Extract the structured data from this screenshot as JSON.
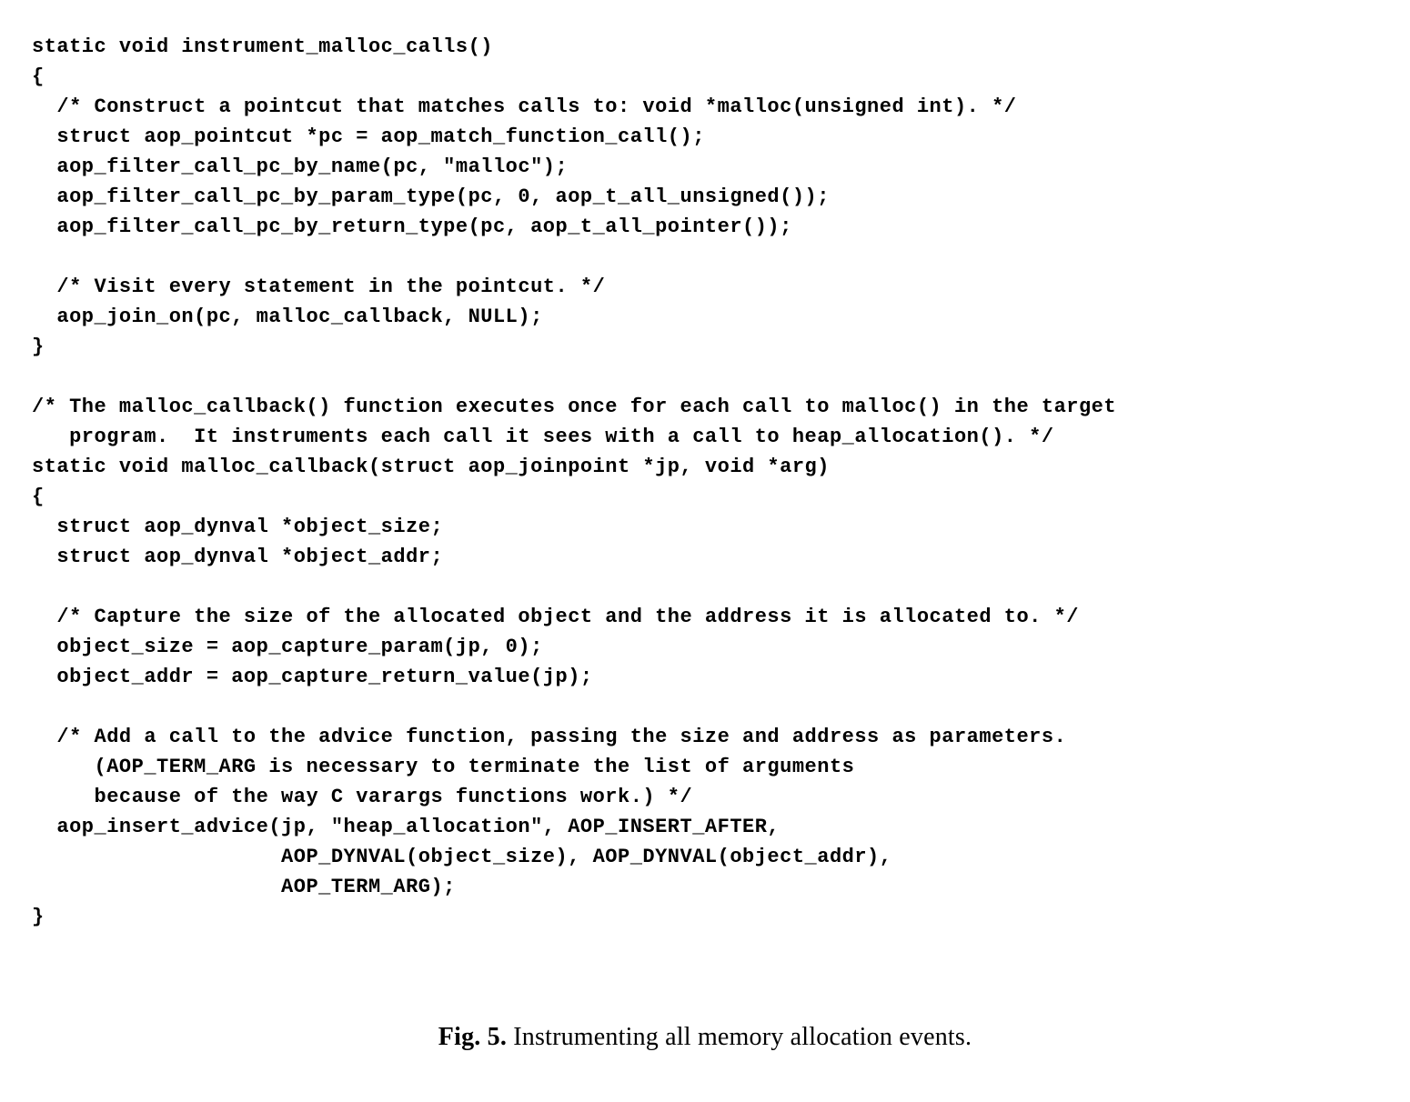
{
  "code": {
    "line1": "static void instrument_malloc_calls()",
    "line2": "{",
    "line3": "  /* Construct a pointcut that matches calls to: void *malloc(unsigned int). */",
    "line4": "  struct aop_pointcut *pc = aop_match_function_call();",
    "line5": "  aop_filter_call_pc_by_name(pc, \"malloc\");",
    "line6": "  aop_filter_call_pc_by_param_type(pc, 0, aop_t_all_unsigned());",
    "line7": "  aop_filter_call_pc_by_return_type(pc, aop_t_all_pointer());",
    "line8": "",
    "line9": "  /* Visit every statement in the pointcut. */",
    "line10": "  aop_join_on(pc, malloc_callback, NULL);",
    "line11": "}",
    "line12": "",
    "line13": "/* The malloc_callback() function executes once for each call to malloc() in the target",
    "line14": "   program.  It instruments each call it sees with a call to heap_allocation(). */",
    "line15": "static void malloc_callback(struct aop_joinpoint *jp, void *arg)",
    "line16": "{",
    "line17": "  struct aop_dynval *object_size;",
    "line18": "  struct aop_dynval *object_addr;",
    "line19": "",
    "line20": "  /* Capture the size of the allocated object and the address it is allocated to. */",
    "line21": "  object_size = aop_capture_param(jp, 0);",
    "line22": "  object_addr = aop_capture_return_value(jp);",
    "line23": "",
    "line24": "  /* Add a call to the advice function, passing the size and address as parameters.",
    "line25": "     (AOP_TERM_ARG is necessary to terminate the list of arguments",
    "line26": "     because of the way C varargs functions work.) */",
    "line27": "  aop_insert_advice(jp, \"heap_allocation\", AOP_INSERT_AFTER,",
    "line28": "                    AOP_DYNVAL(object_size), AOP_DYNVAL(object_addr),",
    "line29": "                    AOP_TERM_ARG);",
    "line30": "}"
  },
  "caption": {
    "label": "Fig. 5.",
    "text": " Instrumenting all memory allocation events."
  }
}
